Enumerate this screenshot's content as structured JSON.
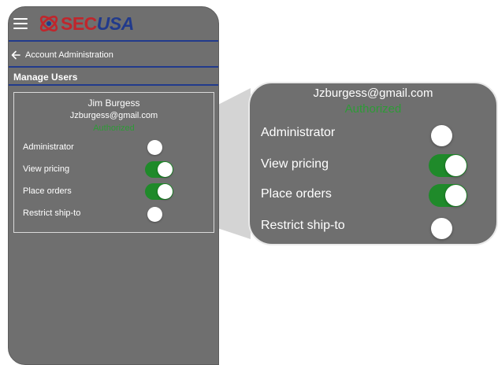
{
  "app": {
    "logo_sec": "SEC",
    "logo_usa": "USA",
    "brand_colors": {
      "red": "#c0262c",
      "blue": "#213a8c"
    },
    "menu_icon": "hamburger-icon"
  },
  "nav": {
    "back_icon": "arrow-left-icon",
    "label": "Account Administration"
  },
  "section": {
    "title": "Manage Users"
  },
  "user": {
    "name": "Jim Burgess",
    "email": "Jzburgess@gmail.com",
    "status": "Authorized",
    "status_color": "#2e9a37"
  },
  "permissions": [
    {
      "label": "Administrator",
      "enabled": false
    },
    {
      "label": "View pricing",
      "enabled": true
    },
    {
      "label": "Place orders",
      "enabled": true
    },
    {
      "label": "Restrict ship-to",
      "enabled": false
    }
  ],
  "zoom": {
    "email": "Jzburgess@gmail.com",
    "status": "Authorized",
    "permissions": [
      {
        "label": "Administrator",
        "enabled": false
      },
      {
        "label": "View pricing",
        "enabled": true
      },
      {
        "label": "Place orders",
        "enabled": true
      },
      {
        "label": "Restrict ship-to",
        "enabled": false
      }
    ]
  },
  "colors": {
    "toggle_on": "#1f8a2a",
    "panel_bg": "#6f6f6f"
  }
}
